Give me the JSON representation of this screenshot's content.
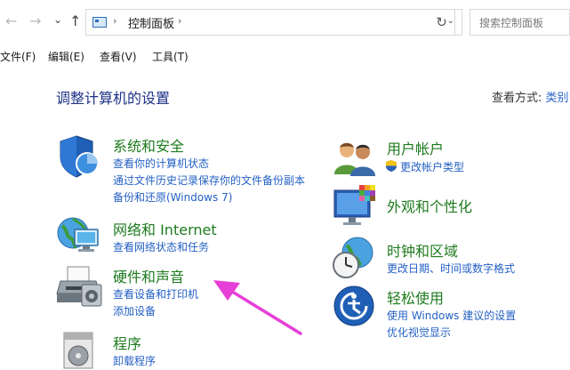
{
  "nav": {
    "back": "←",
    "forward": "→",
    "recent": "⌄",
    "up": "↑"
  },
  "address": {
    "sep1": "›",
    "crumb": "控制面板",
    "sep2": "›",
    "dropdown": "⌄"
  },
  "refresh": "↻",
  "search": {
    "placeholder": "搜索控制面板"
  },
  "menu": [
    "文件(F)",
    "编辑(E)",
    "查看(V)",
    "工具(T)"
  ],
  "heading": "调整计算机的设置",
  "view_by": {
    "label": "查看方式:",
    "value": "类别"
  },
  "categories": {
    "system": {
      "title": "系统和安全",
      "links": [
        "查看你的计算机状态",
        "通过文件历史记录保存你的文件备份副本",
        "备份和还原(Windows 7)"
      ]
    },
    "network": {
      "title": "网络和 Internet",
      "links": [
        "查看网络状态和任务"
      ]
    },
    "hardware": {
      "title": "硬件和声音",
      "links": [
        "查看设备和打印机",
        "添加设备"
      ]
    },
    "programs": {
      "title": "程序",
      "links": [
        "卸载程序"
      ]
    },
    "users": {
      "title": "用户帐户",
      "links": [
        "更改帐户类型"
      ]
    },
    "appearance": {
      "title": "外观和个性化",
      "links": []
    },
    "clock": {
      "title": "时钟和区域",
      "links": [
        "更改日期、时间或数字格式"
      ]
    },
    "ease": {
      "title": "轻松使用",
      "links": [
        "使用 Windows 建议的设置",
        "优化视觉显示"
      ]
    }
  },
  "colors": {
    "title_green": "#1e7a1e",
    "link_blue": "#2461c4",
    "heading_blue": "#1e3287",
    "arrow_magenta": "#e63fd6"
  }
}
